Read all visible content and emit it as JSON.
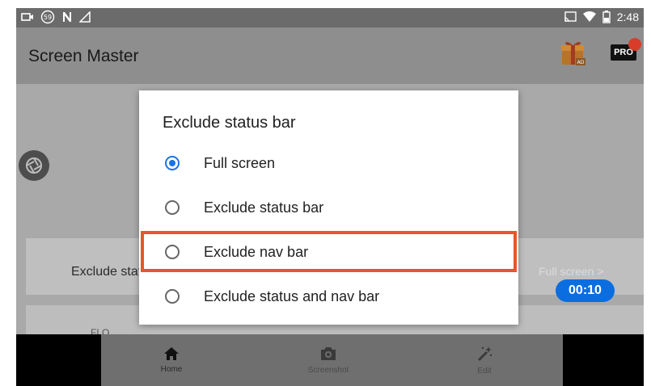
{
  "status_bar": {
    "left_icons": [
      "screen-record-icon",
      "notification-59-icon",
      "n-icon",
      "signal-triangle-icon"
    ],
    "notification_count": "59",
    "right_icons": [
      "cast-icon",
      "wifi-icon",
      "battery-icon"
    ],
    "time": "2:48"
  },
  "app_bar": {
    "title": "Screen Master",
    "gift_icon": "gift-ad-icon",
    "gift_badge": "AD",
    "pro_label": "PRO"
  },
  "background": {
    "shutter_icon": "camera-shutter-icon",
    "setting_label": "Exclude status bar",
    "setting_value": "Full screen",
    "chevron": ">",
    "timer": "00:10",
    "partial_row_text": "FLO..."
  },
  "dialog": {
    "title": "Exclude status bar",
    "options": [
      {
        "label": "Full screen",
        "selected": true
      },
      {
        "label": "Exclude status bar",
        "selected": false
      },
      {
        "label": "Exclude nav bar",
        "selected": false
      },
      {
        "label": "Exclude status and nav bar",
        "selected": false
      }
    ],
    "accent_color": "#1a73e8"
  },
  "highlight_color": "#e8552e",
  "bottom_nav": {
    "items": [
      {
        "label": "Home",
        "icon": "home-icon"
      },
      {
        "label": "Screenshot",
        "icon": "camera-icon"
      },
      {
        "label": "Edit",
        "icon": "magic-wand-icon"
      }
    ]
  }
}
